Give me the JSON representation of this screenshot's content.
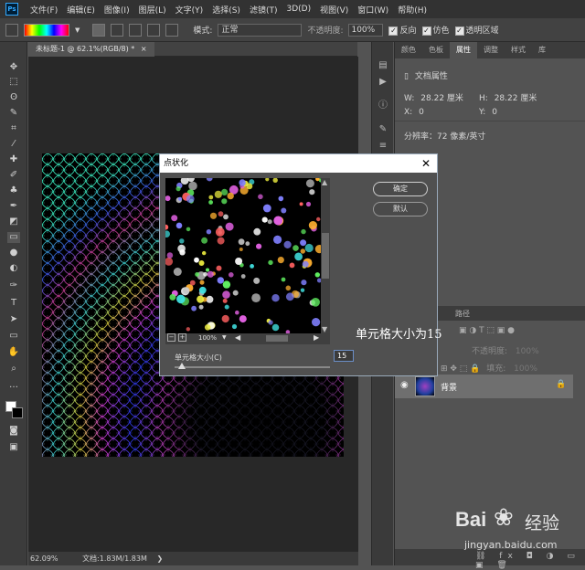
{
  "app": {
    "logo_text": "Ps"
  },
  "menu": [
    "文件(F)",
    "编辑(E)",
    "图像(I)",
    "图层(L)",
    "文字(Y)",
    "选择(S)",
    "滤镜(T)",
    "3D(D)",
    "视图(V)",
    "窗口(W)",
    "帮助(H)"
  ],
  "options_bar": {
    "mode_label": "模式:",
    "mode_value": "正常",
    "opacity_label": "不透明度:",
    "opacity_value": "100%",
    "reverse_label": "反向",
    "dither_label": "仿色",
    "transparency_label": "透明区域"
  },
  "document": {
    "tab_title": "未标题-1 @ 62.1%(RGB/8) *",
    "zoom": "62.09%",
    "doc_info": "文档:1.83M/1.83M"
  },
  "properties_panel": {
    "tabs": [
      "颜色",
      "色板",
      "属性",
      "调整",
      "样式",
      "库"
    ],
    "active_tab": "属性",
    "section_title": "文档属性",
    "w_label": "W:",
    "w_value": "28.22 厘米",
    "h_label": "H:",
    "h_value": "28.22 厘米",
    "x_label": "X:",
    "x_value": "0",
    "y_label": "Y:",
    "y_value": "0",
    "resolution": "分辨率：72 像素/英寸"
  },
  "layers_panel": {
    "tab_paths": "路径",
    "opacity_label": "不透明度:",
    "opacity_value": "100%",
    "fill_label": "填充:",
    "fill_value": "100%",
    "layer_name": "背景"
  },
  "dialog": {
    "title": "点状化",
    "ok_label": "确定",
    "default_label": "默认",
    "zoom": "100%",
    "cell_size_label": "单元格大小(C)",
    "cell_size_value": "15",
    "cell_size": 15
  },
  "annotation": "单元格大小为15",
  "watermark": {
    "logo": "Bai",
    "brand": "经验",
    "url": "jingyan.baidu.com"
  }
}
